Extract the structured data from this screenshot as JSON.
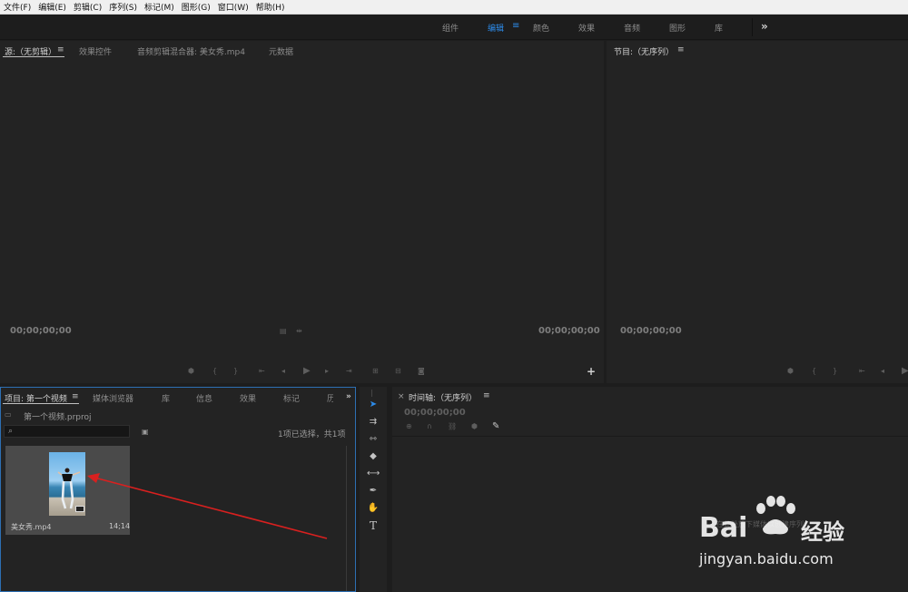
{
  "menubar": {
    "items": [
      "文件(F)",
      "编辑(E)",
      "剪辑(C)",
      "序列(S)",
      "标记(M)",
      "图形(G)",
      "窗口(W)",
      "帮助(H)"
    ]
  },
  "workspaces": {
    "items": [
      "组件",
      "编辑",
      "颜色",
      "效果",
      "音频",
      "图形",
      "库"
    ],
    "active": "编辑",
    "more": "»"
  },
  "source_panel": {
    "tabs": [
      "源:（无剪辑）",
      "效果控件",
      "音频剪辑混合器: 美女秀.mp4",
      "元数据"
    ],
    "timecode_left": "00;00;00;00",
    "timecode_right": "00;00;00;00",
    "add": "+"
  },
  "program_panel": {
    "title": "节目:（无序列）",
    "timecode_left": "00;00;00;00"
  },
  "project_panel": {
    "tabs": [
      "项目: 第一个视频",
      "媒体浏览器",
      "库",
      "信息",
      "效果",
      "标记",
      "历"
    ],
    "more": "»",
    "file_name": "第一个视频.prproj",
    "selection_status": "1项已选择，共1项",
    "clip": {
      "name": "美女秀.mp4",
      "duration": "14;14"
    }
  },
  "timeline_panel": {
    "close": "×",
    "title": "时间轴:（无序列）",
    "timecode": "00;00;00;00",
    "empty_hint": "在此处放下媒体以创建序列。"
  },
  "watermark": {
    "brand": "Bai",
    "brand_tail": "经验",
    "url": "jingyan.baidu.com"
  },
  "colors": {
    "accent": "#2d8ceb",
    "arrow": "#d9201f",
    "panel_bg": "#232323"
  }
}
